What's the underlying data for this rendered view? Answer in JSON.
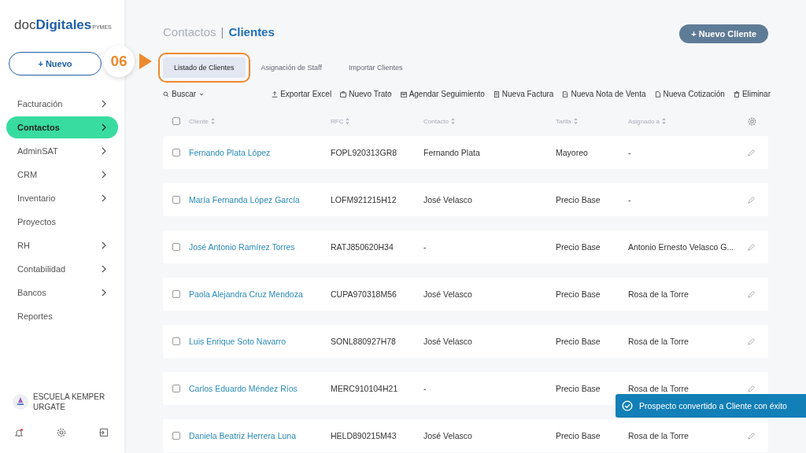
{
  "logo": {
    "prefix": "doc",
    "main": "Digitales",
    "suffix": "PYMES"
  },
  "new_button": {
    "icon": "+",
    "label": "Nuevo"
  },
  "nav": [
    {
      "label": "Facturación",
      "chevron": true,
      "selected": false
    },
    {
      "label": "Contactos",
      "chevron": true,
      "selected": true
    },
    {
      "label": "AdminSAT",
      "chevron": true,
      "selected": false
    },
    {
      "label": "CRM",
      "chevron": true,
      "selected": false
    },
    {
      "label": "Inventario",
      "chevron": true,
      "selected": false
    },
    {
      "label": "Proyectos",
      "chevron": false,
      "selected": false
    },
    {
      "label": "RH",
      "chevron": true,
      "selected": false
    },
    {
      "label": "Contabilidad",
      "chevron": true,
      "selected": false
    },
    {
      "label": "Bancos",
      "chevron": true,
      "selected": false
    },
    {
      "label": "Reportes",
      "chevron": false,
      "selected": false
    }
  ],
  "account": {
    "name": "ESCUELA KEMPER URGATE",
    "notification": true
  },
  "breadcrumb": {
    "parent": "Contactos",
    "separator": "|",
    "current": "Clientes"
  },
  "new_client_button": {
    "icon": "+",
    "label": "Nuevo Cliente"
  },
  "callout": {
    "step": "06"
  },
  "tabs": [
    {
      "label": "Listado de Clientes",
      "selected": true,
      "highlighted": true
    },
    {
      "label": "Asignación de Staff",
      "selected": false,
      "highlighted": false
    },
    {
      "label": "Importar Clientes",
      "selected": false,
      "highlighted": false
    }
  ],
  "search": {
    "label": "Buscar"
  },
  "actions": [
    {
      "kind": "export",
      "label": "Exportar Excel"
    },
    {
      "kind": "deal",
      "label": "Nuevo Trato"
    },
    {
      "kind": "schedule",
      "label": "Agendar Seguimiento"
    },
    {
      "kind": "invoice",
      "label": "Nueva Factura"
    },
    {
      "kind": "note",
      "label": "Nueva Nota de Venta"
    },
    {
      "kind": "quote",
      "label": "Nueva Cotización"
    },
    {
      "kind": "delete",
      "label": "Eliminar"
    }
  ],
  "table": {
    "all_checked": false,
    "columns": [
      "Cliente",
      "RFC",
      "Contacto",
      "Tarifa",
      "Asignado a"
    ],
    "rows": [
      {
        "checked": false,
        "cells": [
          "Fernando Plata López",
          "FOPL920313GR8",
          "Fernando Plata",
          "Mayoreo",
          "-"
        ]
      },
      {
        "checked": false,
        "cells": [
          "María Fernanda López García",
          "LOFM921215H12",
          "José Velasco",
          "Precio Base",
          "-"
        ]
      },
      {
        "checked": false,
        "cells": [
          "José Antonio Ramírez Torres",
          "RATJ850620H34",
          "-",
          "Precio Base",
          "Antonio Ernesto Velasco G..."
        ]
      },
      {
        "checked": false,
        "cells": [
          "Paola Alejandra Cruz Mendoza",
          "CUPA970318M56",
          "José Velasco",
          "Precio Base",
          "Rosa de la Torre"
        ]
      },
      {
        "checked": false,
        "cells": [
          "Luis Enrique Soto Navarro",
          "SONL880927H78",
          "José Velasco",
          "Precio Base",
          "Rosa de la Torre"
        ]
      },
      {
        "checked": false,
        "cells": [
          "Carlos Eduardo Méndez Ríos",
          "MERC910104H21",
          "-",
          "Precio Base",
          "Rosa de la Torre"
        ]
      },
      {
        "checked": false,
        "cells": [
          "Daniela Beatriz Herrera Luna",
          "HELD890215M43",
          "José Velasco",
          "Precio Base",
          "Rosa de la Torre"
        ]
      }
    ]
  },
  "toast": {
    "kind": "success",
    "message": "Prospecto convertido a Cliente con éxito"
  }
}
